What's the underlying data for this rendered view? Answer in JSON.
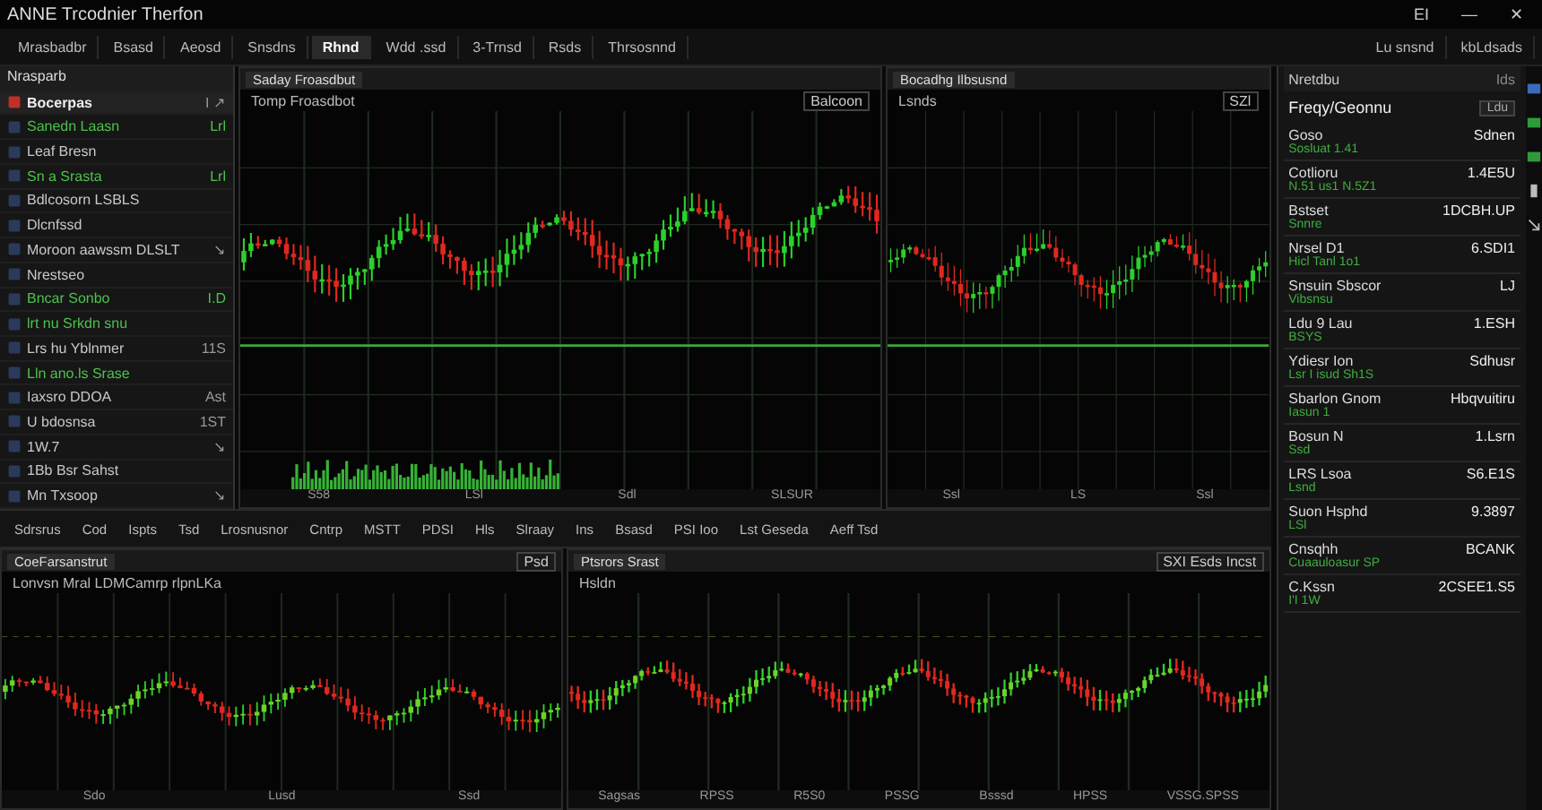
{
  "window": {
    "title": "ANNE Trcodnier Therfon",
    "controls": [
      "EI",
      "—",
      "✕"
    ]
  },
  "toolbar": [
    {
      "label": "Mrasbadbr",
      "selected": false
    },
    {
      "label": "Bsasd",
      "selected": false
    },
    {
      "label": "Aeosd",
      "selected": false
    },
    {
      "label": "Snsdns",
      "selected": false
    },
    {
      "label": "Rhnd",
      "selected": true
    },
    {
      "label": "Wdd .ssd",
      "selected": false
    },
    {
      "label": "3-Trnsd",
      "selected": false
    },
    {
      "label": "Rsds",
      "selected": false
    },
    {
      "label": "Thrsosnnd",
      "selected": false
    }
  ],
  "toolbar_right": [
    "Lu  snsnd",
    "kbLdsads"
  ],
  "watchlist": {
    "title": "Nrasparb",
    "items": [
      {
        "name": "Bocerpas",
        "value": "I ↗",
        "kind": "header"
      },
      {
        "name": "Sanedn Laasn",
        "value": "Lrl",
        "kind": "positive"
      },
      {
        "name": "Leaf Bresn",
        "value": "",
        "kind": "neutral"
      },
      {
        "name": "Sn a Srasta",
        "value": "Lrl",
        "kind": "positive"
      },
      {
        "name": "Bdlcosorn  LSBLS",
        "value": "",
        "kind": "neutral"
      },
      {
        "name": "Dlcnfssd",
        "value": "",
        "kind": "neutral"
      },
      {
        "name": "Moroon aawssm  DLSLT",
        "value": "↘",
        "kind": "neutral"
      },
      {
        "name": "Nrestseo",
        "value": "",
        "kind": "neutral"
      },
      {
        "name": "Bncar Sonbo",
        "value": "I.D",
        "kind": "positive"
      },
      {
        "name": "lrt nu Srkdn snu",
        "value": "",
        "kind": "positive"
      },
      {
        "name": "Lrs hu Yblnmer",
        "value": "11S",
        "kind": "neutral"
      },
      {
        "name": "Lln ano.ls Srase",
        "value": "",
        "kind": "positive"
      },
      {
        "name": "Iaxsro DDOA",
        "value": "Ast",
        "kind": "neutral"
      },
      {
        "name": "U bdosnsa",
        "value": "1ST",
        "kind": "neutral"
      },
      {
        "name": "1W.7",
        "value": "↘",
        "kind": "neutral"
      },
      {
        "name": "1Bb Bsr  Sahst",
        "value": "",
        "kind": "neutral"
      },
      {
        "name": "Mn  Txsoop",
        "value": "↘",
        "kind": "neutral"
      }
    ]
  },
  "charts": [
    {
      "tab": "Saday Froasdbut",
      "title": "Tomp Froasdbot",
      "legend": "Balcoon",
      "footer": [
        "S58",
        "LSl",
        "Sdl",
        "SLSUR"
      ]
    },
    {
      "tab": "Bocadhg Ilbsusnd",
      "title": "Lsnds",
      "legend": "SZl",
      "footer": [
        "Ssl",
        "LS",
        "Ssl"
      ]
    },
    {
      "tab": "CoeFarsanstrut",
      "title": "Lonvsn  Mral LDMCamrp rlpnLKa",
      "legend": "Psd",
      "footer": [
        "Sdo",
        "Lusd",
        "Ssd"
      ]
    },
    {
      "tab": "Ptsrors Srast",
      "title": "Hsldn",
      "legend": "SXI Esds  Incst",
      "footer": [
        "Sagsas",
        "RPSS",
        "R5S0",
        "PSSG",
        "Bsssd",
        "HPSS",
        "VSSG.SPSS"
      ]
    }
  ],
  "bottom_toolbar": [
    "Sdrsrus",
    "Cod",
    "Ispts",
    "Tsd",
    "Lrosnusnor",
    "Cntrp",
    "MSTT",
    "PDSI",
    "Hls",
    "Slraay",
    "Ins",
    "Bsasd",
    "PSI Ioo",
    "Lst Geseda",
    "Aeff Tsd"
  ],
  "side_panel": {
    "header": "Nretdbu",
    "header_value": "Ids",
    "title": "Freqy/Geonnu",
    "title_value": "Ldu",
    "rows": [
      {
        "label": "Goso",
        "value": "Sdnen",
        "detail": "Sosluat   1.41"
      },
      {
        "label": "Cotlioru",
        "value": "1.4E5U",
        "detail": "N.51 us1   N.5Z1"
      },
      {
        "label": "Bstset",
        "value": "1DCBH.UP",
        "detail": "Snnre"
      },
      {
        "label": "Nrsel D1",
        "value": "6.SDI1",
        "detail": "Hicl   Tanl 1o1"
      },
      {
        "label": "Snsuin Sbscor",
        "value": "LJ",
        "detail": "Vibsnsu"
      },
      {
        "label": "Ldu 9 Lau",
        "value": "1.ESH",
        "detail": "BSYS"
      },
      {
        "label": "Ydiesr Ion",
        "value": "Sdhusr",
        "detail": "Lsr I isud   Sh1S"
      },
      {
        "label": "Sbarlon Gnom",
        "value": "Hbqvuitiru",
        "detail": "Iasun 1"
      },
      {
        "label": "Bosun N",
        "value": "1.Lsrn",
        "detail": "Ssd"
      },
      {
        "label": "LRS Lsoa",
        "value": "S6.E1S",
        "detail": "Lsnd"
      },
      {
        "label": "Suon Hsphd",
        "value": "9.3897",
        "detail": "LSl"
      },
      {
        "label": "Cnsqhh",
        "value": "BCANK",
        "detail": "Cuaauloasur   SP"
      },
      {
        "label": "C.Kssn",
        "value": "2CSEE1.S5",
        "detail": "I'I   1W"
      }
    ]
  }
}
